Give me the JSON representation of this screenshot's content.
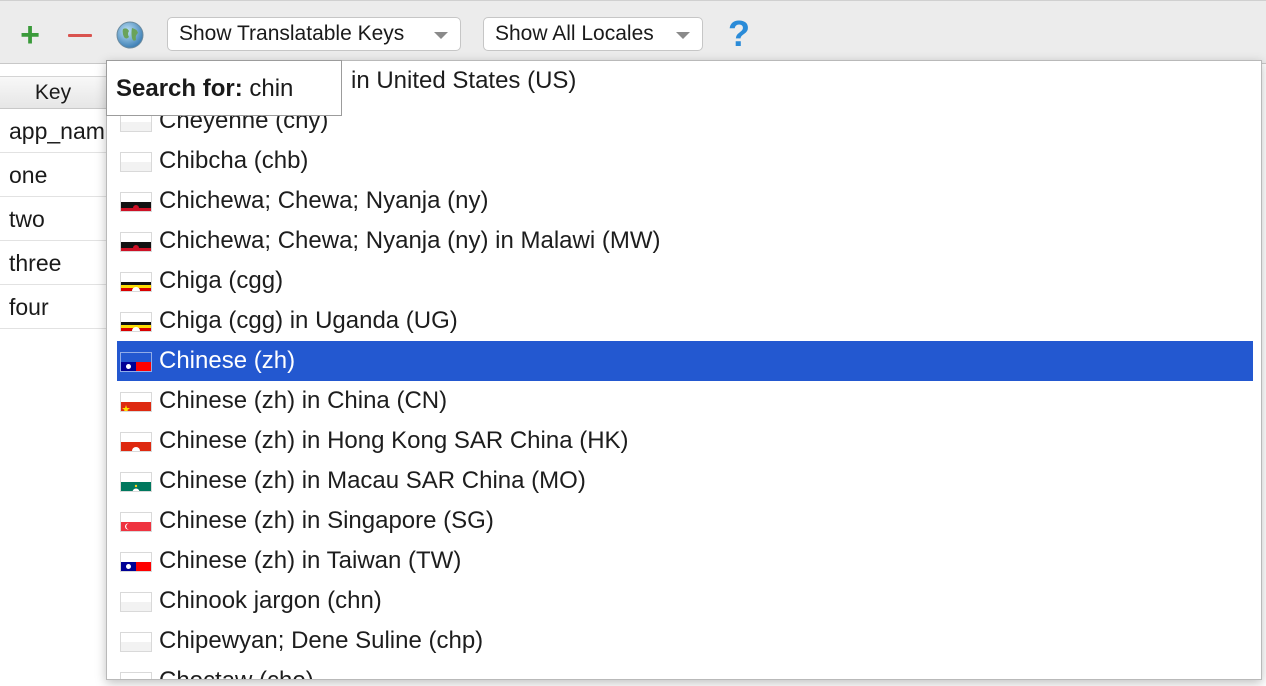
{
  "toolbar": {
    "add_icon": "plus-icon",
    "remove_icon": "minus-icon",
    "globe_icon": "globe-icon",
    "filter_keys": "Show Translatable Keys",
    "filter_locales": "Show All Locales",
    "help_label": "?"
  },
  "table": {
    "key_header": "Key",
    "keys": [
      "app_nam",
      "one",
      "two",
      "three",
      "four"
    ]
  },
  "search": {
    "label": "Search for:",
    "query": "chin"
  },
  "locales": {
    "top_partial": "in United States (US)",
    "items": [
      {
        "label": "Cheyenne (chy)",
        "flag": "blank"
      },
      {
        "label": "Chibcha (chb)",
        "flag": "blank"
      },
      {
        "label": "Chichewa; Chewa; Nyanja (ny)",
        "flag": "mw"
      },
      {
        "label": "Chichewa; Chewa; Nyanja (ny) in Malawi (MW)",
        "flag": "mw"
      },
      {
        "label": "Chiga (cgg)",
        "flag": "ug"
      },
      {
        "label": "Chiga (cgg) in Uganda (UG)",
        "flag": "ug"
      },
      {
        "label": "Chinese (zh)",
        "flag": "tw",
        "selected": true
      },
      {
        "label": "Chinese (zh) in China (CN)",
        "flag": "cn"
      },
      {
        "label": "Chinese (zh) in Hong Kong SAR China (HK)",
        "flag": "hk"
      },
      {
        "label": "Chinese (zh) in Macau SAR China (MO)",
        "flag": "mo"
      },
      {
        "label": "Chinese (zh) in Singapore (SG)",
        "flag": "sg"
      },
      {
        "label": "Chinese (zh) in Taiwan (TW)",
        "flag": "tw"
      },
      {
        "label": "Chinook jargon (chn)",
        "flag": "blank"
      },
      {
        "label": "Chipewyan; Dene Suline (chp)",
        "flag": "blank"
      },
      {
        "label": "Choctaw (cho)",
        "flag": "blank"
      }
    ]
  },
  "colors": {
    "selection": "#2358d0",
    "add": "#3a9a3a",
    "remove": "#d9534f",
    "help": "#2a8bd8"
  }
}
